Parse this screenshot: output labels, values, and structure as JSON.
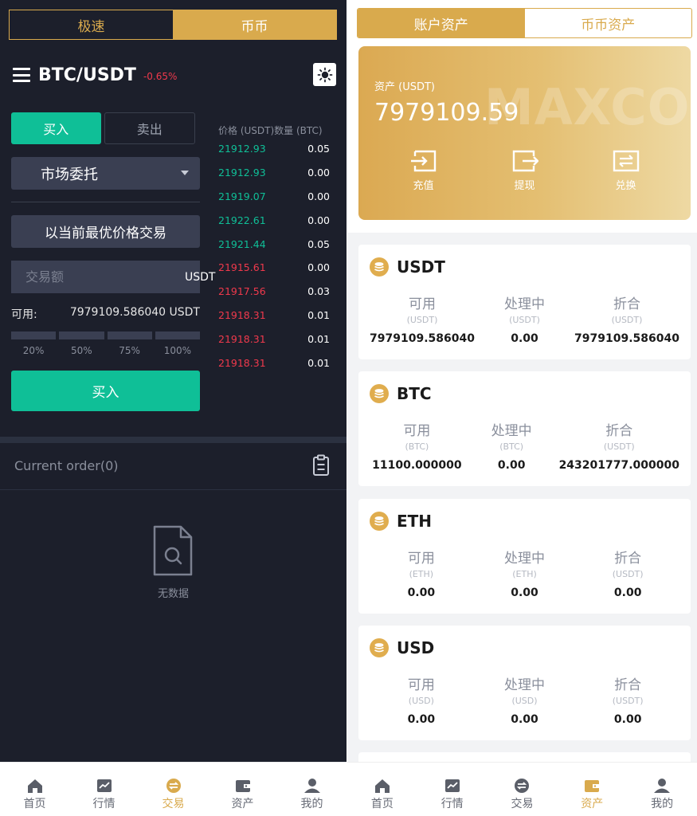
{
  "colors": {
    "gold": "#d9aa4d",
    "green": "#0fbf97",
    "red": "#f0394c",
    "dark_bg": "#1c1f2b"
  },
  "trade": {
    "mode_tabs": [
      "极速",
      "币币"
    ],
    "pair": "BTC/USDT",
    "change": "-0.65%",
    "buy_tab": "买入",
    "sell_tab": "卖出",
    "order_type": "市场委托",
    "best_price": "以当前最优价格交易",
    "amount_placeholder": "交易额",
    "amount_unit": "USDT",
    "available_label": "可用:",
    "available_value": "7979109.586040 USDT",
    "percent_options": [
      "20%",
      "50%",
      "75%",
      "100%"
    ],
    "submit": "买入",
    "book_price_header": "价格 (USDT)",
    "book_qty_header": "数量 (BTC)",
    "order_book": [
      {
        "price": "21912.93",
        "qty": "0.05",
        "side": "up"
      },
      {
        "price": "21912.93",
        "qty": "0.00",
        "side": "up"
      },
      {
        "price": "21919.07",
        "qty": "0.00",
        "side": "up"
      },
      {
        "price": "21922.61",
        "qty": "0.00",
        "side": "up"
      },
      {
        "price": "21921.44",
        "qty": "0.05",
        "side": "up"
      },
      {
        "price": "21915.61",
        "qty": "0.00",
        "side": "down"
      },
      {
        "price": "21917.56",
        "qty": "0.03",
        "side": "down"
      },
      {
        "price": "21918.31",
        "qty": "0.01",
        "side": "down"
      },
      {
        "price": "21918.31",
        "qty": "0.01",
        "side": "down"
      },
      {
        "price": "21918.31",
        "qty": "0.01",
        "side": "down"
      }
    ],
    "current_order": "Current order(0)",
    "empty_text": "无数据"
  },
  "assets": {
    "tabs": [
      "账户资产",
      "币币资产"
    ],
    "card": {
      "label": "资产 (USDT)",
      "total": "7979109.59",
      "watermark": "MAXCOR",
      "actions": [
        {
          "label": "充值",
          "icon": "deposit-icon"
        },
        {
          "label": "提现",
          "icon": "withdraw-icon"
        },
        {
          "label": "兑换",
          "icon": "exchange-icon"
        }
      ]
    },
    "col_titles": [
      "可用",
      "处理中",
      "折合"
    ],
    "coins": [
      {
        "name": "USDT",
        "units": [
          "(USDT)",
          "(USDT)",
          "(USDT)"
        ],
        "values": [
          "7979109.586040",
          "0.00",
          "7979109.586040"
        ]
      },
      {
        "name": "BTC",
        "units": [
          "(BTC)",
          "(BTC)",
          "(USDT)"
        ],
        "values": [
          "11100.000000",
          "0.00",
          "243201777.000000"
        ]
      },
      {
        "name": "ETH",
        "units": [
          "(ETH)",
          "(ETH)",
          "(USDT)"
        ],
        "values": [
          "0.00",
          "0.00",
          "0.00"
        ]
      },
      {
        "name": "USD",
        "units": [
          "(USD)",
          "(USD)",
          "(USDT)"
        ],
        "values": [
          "0.00",
          "0.00",
          "0.00"
        ]
      }
    ]
  },
  "nav": {
    "items": [
      {
        "label": "首页",
        "icon": "home-icon"
      },
      {
        "label": "行情",
        "icon": "market-icon"
      },
      {
        "label": "交易",
        "icon": "trade-icon"
      },
      {
        "label": "资产",
        "icon": "wallet-icon"
      },
      {
        "label": "我的",
        "icon": "profile-icon"
      }
    ],
    "left_active": 2,
    "right_active": 3
  }
}
